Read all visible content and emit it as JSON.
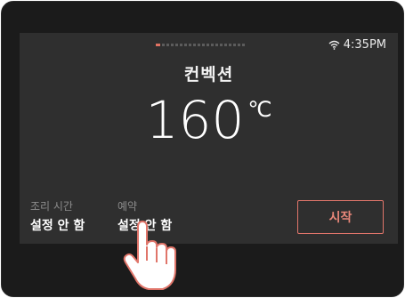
{
  "status": {
    "time": "4:35PM",
    "wifi_icon": "wifi-icon"
  },
  "pager": {
    "total": 20,
    "active_index": 0
  },
  "mode": {
    "name": "컨벡션"
  },
  "temperature": {
    "value": "160",
    "unit": "℃"
  },
  "cook_time": {
    "label": "조리 시간",
    "value": "설정 안 함"
  },
  "reservation": {
    "label": "예약",
    "value": "설정 안 함"
  },
  "start_button": {
    "label": "시작"
  },
  "colors": {
    "accent": "#e0756a",
    "screen": "#2f2f2f",
    "bezel": "#1b1b1b"
  }
}
